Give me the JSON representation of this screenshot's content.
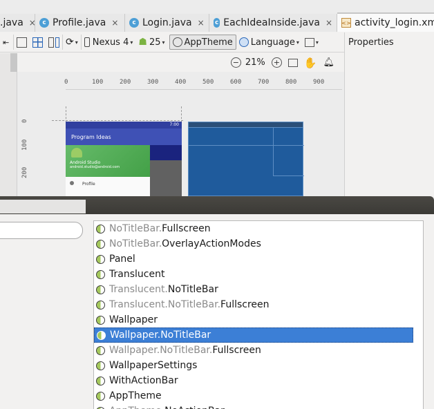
{
  "tabs": [
    {
      "label": ".java",
      "icon": "none",
      "active": false
    },
    {
      "label": "Profile.java",
      "icon": "c-class-icon",
      "active": false
    },
    {
      "label": "Login.java",
      "icon": "c-class-icon",
      "active": false
    },
    {
      "label": "EachIdeaInside.java",
      "icon": "c-class-icon",
      "active": false
    },
    {
      "label": "activity_login.xm",
      "icon": "xml-file-icon",
      "active": true
    }
  ],
  "tab_close_glyph": "×",
  "toolbar": {
    "device": "Nexus 4",
    "api": "25",
    "theme": "AppTheme",
    "language": "Language",
    "caret": "▾"
  },
  "properties_title": "Properties",
  "zoom": {
    "value": "21%",
    "minus": "−",
    "plus": "+"
  },
  "ruler": {
    "x_ticks": [
      "0",
      "100",
      "200",
      "300",
      "400",
      "500",
      "600",
      "700",
      "800",
      "900"
    ],
    "y_ticks": [
      "0",
      "100",
      "200"
    ]
  },
  "preview": {
    "status_time": "7:00",
    "app_title": "Program Ideas",
    "drawer_name": "Android Studio",
    "drawer_email": "android.studio@android.com",
    "menu_item": "Profile"
  },
  "theme_list": [
    {
      "prefix": "NoTitleBar.",
      "name": "Fullscreen",
      "selected": false
    },
    {
      "prefix": "NoTitleBar.",
      "name": "OverlayActionModes",
      "selected": false
    },
    {
      "prefix": "",
      "name": "Panel",
      "selected": false
    },
    {
      "prefix": "",
      "name": "Translucent",
      "selected": false
    },
    {
      "prefix": "Translucent.",
      "name": "NoTitleBar",
      "selected": false
    },
    {
      "prefix": "Translucent.NoTitleBar.",
      "name": "Fullscreen",
      "selected": false
    },
    {
      "prefix": "",
      "name": "Wallpaper",
      "selected": false
    },
    {
      "prefix": "Wallpaper.",
      "name": "NoTitleBar",
      "selected": true
    },
    {
      "prefix": "Wallpaper.NoTitleBar.",
      "name": "Fullscreen",
      "selected": false
    },
    {
      "prefix": "",
      "name": "WallpaperSettings",
      "selected": false
    },
    {
      "prefix": "",
      "name": "WithActionBar",
      "selected": false
    },
    {
      "prefix": "",
      "name": "AppTheme",
      "selected": false
    },
    {
      "prefix": "AppTheme.",
      "name": "NoActionBar",
      "selected": false
    }
  ],
  "colors": {
    "selection": "#3c7fd6",
    "appbar": "#3f51b5",
    "blueprint": "#1f5b9c"
  }
}
